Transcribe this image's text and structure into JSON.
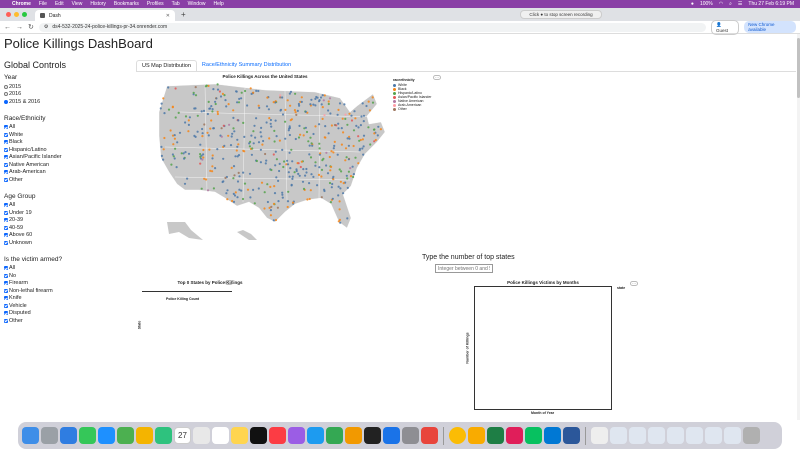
{
  "menubar": {
    "app": "Chrome",
    "items": [
      "File",
      "Edit",
      "View",
      "History",
      "Bookmarks",
      "Profiles",
      "Tab",
      "Window",
      "Help"
    ],
    "battery": "100%",
    "clock": "Thu 27 Feb 6:19 PM"
  },
  "browser": {
    "tab_title": "Dash",
    "recording_pill": "Click ● to stop screen recording",
    "url": "ds4-532-2025-24-police-killings-pr-34.onrender.com",
    "guest_label": "Guest",
    "new_chrome_label": "New Chrome available"
  },
  "page": {
    "title": "Police Killings DashBoard",
    "controls_title": "Global Controls",
    "year_label": "Year",
    "year_options": [
      "2015",
      "2016",
      "2015 & 2016"
    ],
    "race_label": "Race/Ethnicity",
    "race_options": [
      "All",
      "White",
      "Black",
      "Hispanic/Latino",
      "Asian/Pacific Islander",
      "Native American",
      "Arab-American",
      "Other"
    ],
    "age_label": "Age Group",
    "age_options": [
      "All",
      "Under 19",
      "20-39",
      "40-59",
      "Above 60",
      "Unknown"
    ],
    "armed_label": "Is the victim armed?",
    "armed_options": [
      "All",
      "No",
      "Firearm",
      "Non-lethal firearm",
      "Knife",
      "Vehicle",
      "Disputed",
      "Other"
    ],
    "tabs": [
      "US Map Distribution",
      "Race/Ethnicity Summary Distribution"
    ],
    "map_title": "Police Killings Across the United States",
    "legend_title": "raceethnicity",
    "legend": [
      {
        "label": "White",
        "color": "#4c78a8"
      },
      {
        "label": "Black",
        "color": "#f58518"
      },
      {
        "label": "Hispanic/Latino",
        "color": "#54a24b"
      },
      {
        "label": "Asian/Pacific Islander",
        "color": "#e45756"
      },
      {
        "label": "Native American",
        "color": "#b279a2"
      },
      {
        "label": "Arab-American",
        "color": "#ff9da6"
      },
      {
        "label": "Other",
        "color": "#9d755d"
      }
    ],
    "topn_label": "Type the number of top states",
    "topn_placeholder": "Integer between 0 and 51",
    "bar_title": "Top 0 States by Police Killings",
    "bar_ylabel": "State",
    "bar_xlabel": "Police Killing Count",
    "month_title": "Police Killings Victims by Months",
    "month_ylabel": "Number of Killings",
    "month_xlabel": "Month of Year",
    "month_legend": "state",
    "more": "···"
  }
}
